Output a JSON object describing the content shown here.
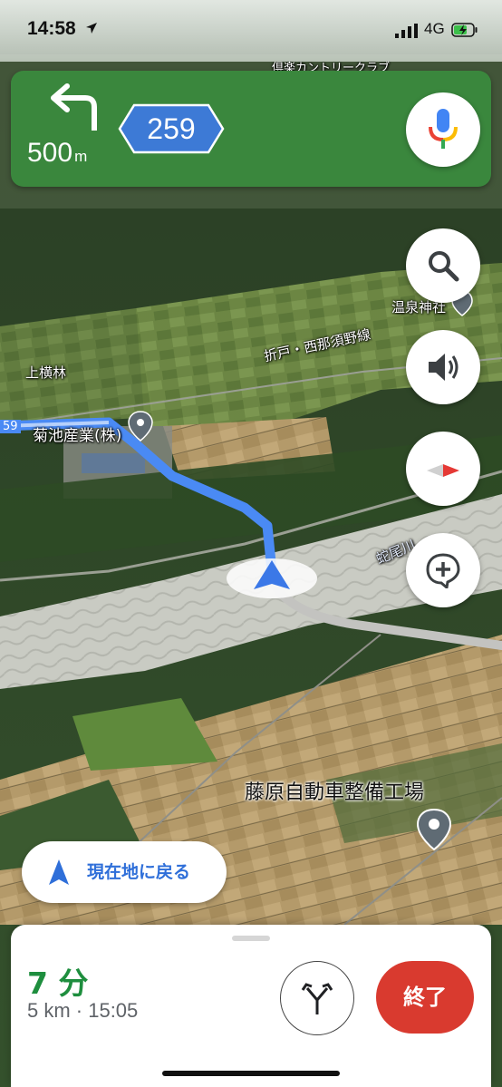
{
  "status_bar": {
    "time": "14:58",
    "network": "4G",
    "location_icon": "location-arrow-icon",
    "signal_icon": "signal-bars-icon",
    "battery_icon": "battery-charging-icon"
  },
  "nav_banner": {
    "maneuver_icon": "turn-left-arrow-icon",
    "distance_value": "500",
    "distance_unit": "m",
    "route_number": "259",
    "mic_icon": "microphone-icon",
    "color": "#3a873d"
  },
  "map": {
    "labels": {
      "country_club": "倶楽カントリークラブ",
      "onsen_shrine": "温泉神社",
      "road_name": "折戸・西那須野線",
      "kamiyokobayashi": "上横林",
      "kikuchi": "菊池産業(株)",
      "edge_route": "59",
      "river": "蛇尾川",
      "poi_name": "藤原自動車整備工場"
    },
    "route_color": "#4a8af4"
  },
  "fabs": {
    "search_icon": "search-icon",
    "sound_icon": "speaker-icon",
    "compass_icon": "compass-icon",
    "add_report_icon": "add-report-icon"
  },
  "recenter": {
    "label": "現在地に戻る",
    "icon": "navigation-arrow-icon"
  },
  "bottom_sheet": {
    "duration": "7 分",
    "details": "5 km · 15:05",
    "route_options_icon": "alternate-routes-icon",
    "exit_label": "終了",
    "exit_color": "#d93a2f"
  }
}
